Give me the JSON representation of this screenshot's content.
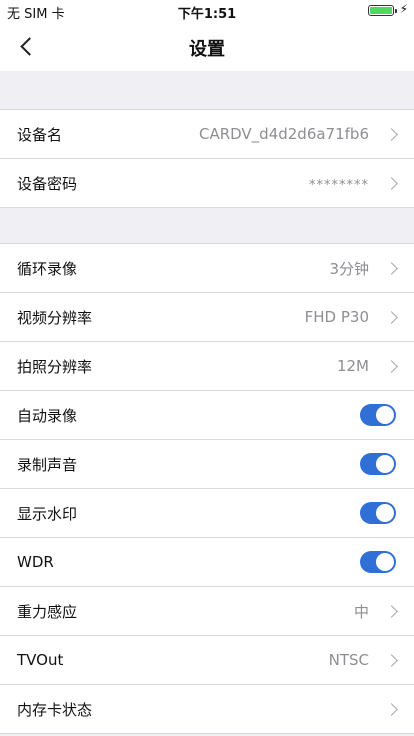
{
  "status_bar": {
    "carrier": "无 SIM 卡",
    "time": "下午1:51",
    "battery_color": "#4cd964"
  },
  "nav": {
    "title": "设置"
  },
  "device_group": [
    {
      "label": "设备名",
      "value": "CARDV_d4d2d6a71fb6"
    },
    {
      "label": "设备密码",
      "value": "********"
    }
  ],
  "settings_group": [
    {
      "label": "循环录像",
      "value": "3分钟",
      "type": "select"
    },
    {
      "label": "视频分辨率",
      "value": "FHD P30",
      "type": "select"
    },
    {
      "label": "拍照分辨率",
      "value": "12M",
      "type": "select"
    },
    {
      "label": "自动录像",
      "type": "toggle",
      "on": true
    },
    {
      "label": "录制声音",
      "type": "toggle",
      "on": true
    },
    {
      "label": "显示水印",
      "type": "toggle",
      "on": true
    },
    {
      "label": "WDR",
      "type": "toggle",
      "on": true
    },
    {
      "label": "重力感应",
      "value": "中",
      "type": "select"
    },
    {
      "label": "TVOut",
      "value": "NTSC",
      "type": "select"
    },
    {
      "label": "内存卡状态",
      "value": "",
      "type": "select"
    }
  ],
  "accent_color": "#2f6fd6"
}
